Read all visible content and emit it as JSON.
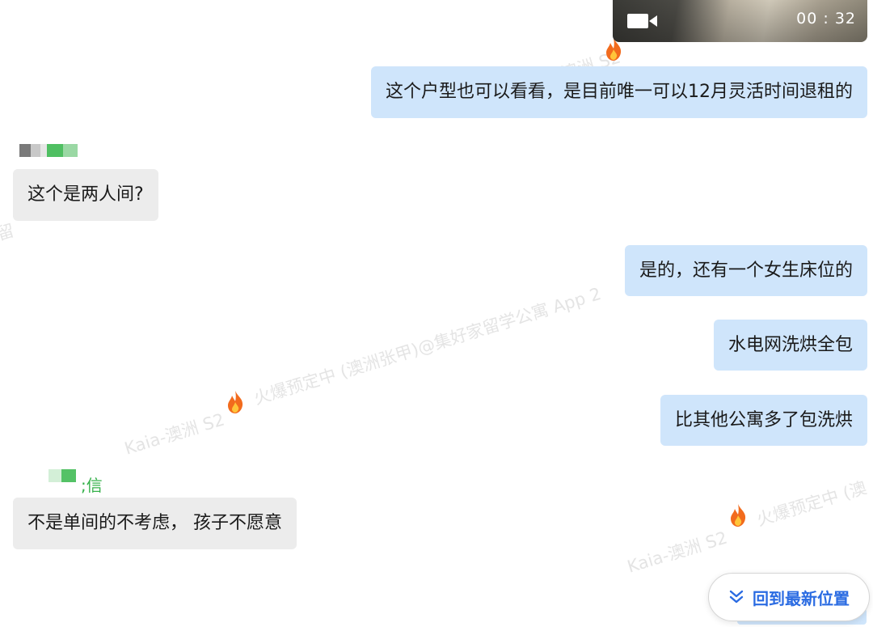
{
  "video": {
    "icon": "video-camera-icon",
    "duration": "00 : 32"
  },
  "messages": [
    {
      "direction": "outgoing",
      "text": "这个户型也可以看看，是目前唯一可以12月灵活时间退租的"
    },
    {
      "direction": "incoming",
      "text": "这个是两人间?"
    },
    {
      "direction": "outgoing",
      "text": "是的，还有一个女生床位的"
    },
    {
      "direction": "outgoing",
      "text": "水电网洗烘全包"
    },
    {
      "direction": "outgoing",
      "text": "比其他公寓多了包洗烘"
    },
    {
      "direction": "incoming",
      "text": "不是单间的不考虑， 孩子不愿意"
    }
  ],
  "sender_names": {
    "second_visible_suffix": ";信"
  },
  "watermark": {
    "lines": [
      "Kaia-澳洲 S2",
      "火爆预定中 (澳洲张甲)@集好家留学公寓 App 2",
      "Kaia-澳洲 S2",
      "火爆预定中 (澳"
    ],
    "icon": "flame-icon"
  },
  "jump_button": {
    "label": "回到最新位置",
    "icon": "double-chevron-down-icon"
  },
  "colors": {
    "outgoing_bubble": "#cfe5fb",
    "incoming_bubble": "#ececec",
    "accent": "#2a6be2",
    "name_green": "#35b14a"
  }
}
